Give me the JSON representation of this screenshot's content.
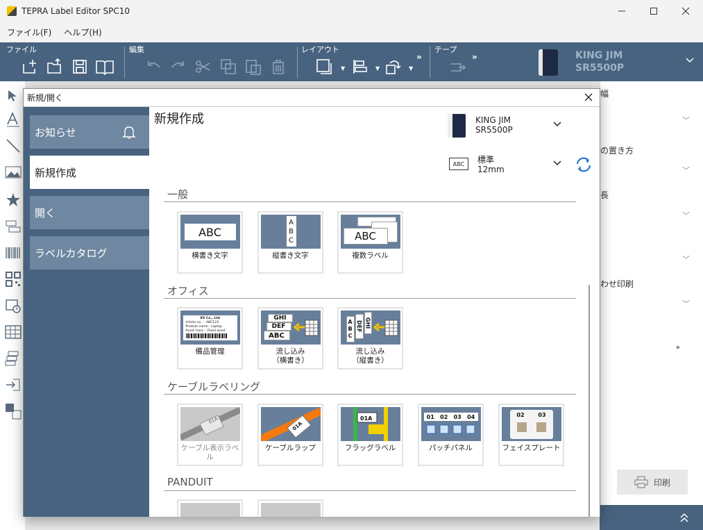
{
  "window": {
    "title": "TEPRA Label Editor SPC10"
  },
  "menu": [
    "ファイル(F)",
    "ヘルプ(H)"
  ],
  "ribbon": {
    "groups": [
      "ファイル",
      "編集",
      "レイアウト",
      "テープ"
    ],
    "printer_line1": "KING JIM",
    "printer_line2": "SR5500P"
  },
  "right_panel": {
    "labels": [
      "幅",
      "の置き方",
      "長",
      "わせ印刷"
    ],
    "print_label": "印刷"
  },
  "dialog": {
    "title": "新規/開く",
    "sidebar": [
      {
        "label": "お知らせ"
      },
      {
        "label": "新規作成"
      },
      {
        "label": "開く"
      },
      {
        "label": "ラベルカタログ"
      }
    ],
    "main_title": "新規作成",
    "printer_line1": "KING JIM",
    "printer_line2": "SR5500P",
    "tape_icon_text": "ABC",
    "tape_line1": "標準",
    "tape_line2": "12mm",
    "sections": [
      {
        "title": "一般",
        "tiles": [
          "横書き文字",
          "縦書き文字",
          "複数ラベル"
        ]
      },
      {
        "title": "オフィス",
        "tiles": [
          "備品管理",
          "流し込み\n（横書き）",
          "流し込み\n（縦書き）"
        ]
      },
      {
        "title": "ケーブルラベリング",
        "tiles": [
          "ケーブル表示ラベル",
          "ケーブルラップ",
          "フラッグラベル",
          "パッチパネル",
          "フェイスプレート"
        ]
      },
      {
        "title": "PANDUIT",
        "tiles": []
      }
    ],
    "thumb_text": {
      "abc": "ABC",
      "v_a": "A",
      "v_b": "B",
      "v_c": "C",
      "office_co": "XX Co., Ltd",
      "office_l1": "Article no. ：ABC123",
      "office_l2": "Product name：Laptop",
      "office_l3": "Asset class ：Fixed asset",
      "ghi": "GHI",
      "def": "DEF",
      "cable_01a": "01A",
      "patch": [
        "01",
        "02",
        "03",
        "04"
      ],
      "face": [
        "02",
        "03"
      ]
    }
  }
}
